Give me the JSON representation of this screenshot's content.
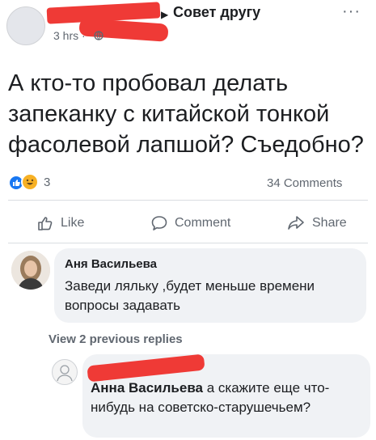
{
  "header": {
    "group_name": "Совет другу",
    "timestamp": "3 hrs ·",
    "more_label": "···"
  },
  "post": {
    "text": "А кто-то пробовал делать запеканку с китайской тонкой фасолевой лапшой? Съедобно?"
  },
  "reactions": {
    "count": "3",
    "comments_count": "34 Comments"
  },
  "actions": {
    "like_label": "Like",
    "comment_label": "Comment",
    "share_label": "Share"
  },
  "comments": [
    {
      "author": "Аня Васильева",
      "text": "Заведи ляльку ,будет меньше времени вопросы задавать"
    }
  ],
  "view_replies": "View 2 previous replies",
  "reply": {
    "mention": "Анна Васильева",
    "text": " а скажите еще что-нибудь на советско-старушечьем?"
  },
  "colors": {
    "brand_blue": "#1877f2",
    "redaction": "#ef3a36",
    "bubble": "#f0f2f5",
    "secondary_text": "#606770"
  }
}
